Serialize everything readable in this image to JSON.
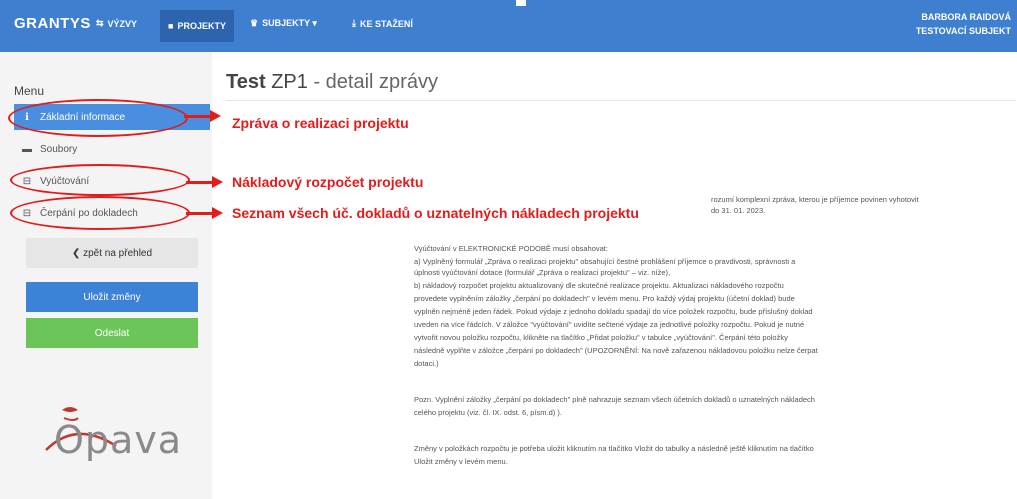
{
  "topbar": {
    "brand": "GRANTYS",
    "nav": [
      {
        "icon": "⇆",
        "label": "VÝZVY"
      },
      {
        "icon": "■",
        "label": "PROJEKTY"
      },
      {
        "icon": "♛",
        "label": "SUBJEKTY ▾"
      },
      {
        "icon": "⤓",
        "label": "KE STAŽENÍ"
      }
    ],
    "user_name": "BARBORA RAIDOVÁ",
    "user_subject": "TESTOVACÍ SUBJEKT"
  },
  "sidebar": {
    "menu_title": "Menu",
    "items": [
      {
        "icon": "ℹ",
        "label": "Základní informace"
      },
      {
        "icon": "▬",
        "label": "Soubory"
      },
      {
        "icon": "⊟",
        "label": "Vyúčtování"
      },
      {
        "icon": "⊟",
        "label": "Čerpání po dokladech"
      }
    ],
    "back_label": "❮ zpět na přehled",
    "save_label": "Uložit změny",
    "send_label": "Odeslat",
    "logo_text": "Opava"
  },
  "main": {
    "title_bold": "Test",
    "title_code": "ZP1",
    "title_rest": "- detail zprávy",
    "intro_1": "rozumí komplexní zpráva, kterou je příjemce povinen vyhotovit",
    "intro_2": "do 31. 01. 2023.",
    "p1": "Vyúčtování v ELEKTRONICKÉ PODOBĚ musí obsahovat:",
    "p2": "a)   Vyplněný formulář „Zpráva o realizaci projektu\" obsahující čestné prohlášení příjemce o pravdivosti, správnosti a",
    "p3": "úplnosti vyúčtování dotace (formulář „Zpráva o realizaci projektu\" – viz. níže),",
    "p4": "b)   nákladový rozpočet projektu aktualizovaný dle skutečné realizace projektu. Aktualizaci nákladového rozpočtu",
    "p5": "provedete vyplněním záložky „čerpání po dokladech\" v levém menu. Pro každý výdaj projektu (účetní doklad) bude",
    "p6": "vyplněn nejméně jeden řádek. Pokud výdaje z jednoho dokladu spadají do více položek rozpočtu, bude příslušný doklad",
    "p7": "uveden na více řádcích. V záložce \"vyúčtování\" uvidíte sečtené výdaje za jednotlivé položky rozpočtu. Pokud je nutné",
    "p8": "vytvořit novou položku rozpočtu, klikněte na tlačítko „Přidat položku\" v tabulce „vyúčtování\". Čerpání této položky",
    "p9": "následně vyplňte v záložce „čerpání po dokladech\" (UPOZORNĚNÍ: Na nově zařazenou nákladovou položku nelze čerpat",
    "p10": "dotaci.)",
    "p11": "Pozn. Vyplnění záložky „čerpání po dokladech\" plně nahrazuje seznam všech účetních dokladů o uznatelných nákladech",
    "p12": "celého projektu (viz. čl. IX. odst. 6, písm.d) ).",
    "p13": "Změny v položkách rozpočtu je potřeba uložit kliknutím na tlačítko Vložit do tabulky a následně ještě kliknutím na tlačítko",
    "p14": "Uložit změny v levém menu."
  },
  "annotations": {
    "a1": "Zpráva o realizaci projektu",
    "a2": "Nákladový rozpočet projektu",
    "a3": "Seznam všech úč. dokladů o uznatelných nákladech projektu"
  },
  "colors": {
    "accent": "#3f7fd0",
    "annotation": "#e21b1b",
    "send": "#6cc558"
  }
}
